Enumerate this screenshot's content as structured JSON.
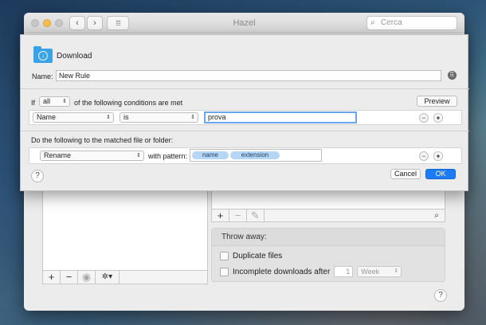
{
  "window": {
    "title": "Hazel",
    "search_placeholder": "Cerca",
    "back_glyph": "‹",
    "forward_glyph": "›"
  },
  "sheet": {
    "folder_name": "Download",
    "name_label": "Name:",
    "name_value": "New Rule",
    "if_label": "If",
    "match_mode": "all",
    "conditions_suffix": "of the following conditions are met",
    "preview_label": "Preview",
    "condition": {
      "attribute": "Name",
      "operator": "is",
      "value": "prova"
    },
    "actions_label": "Do the following to the matched file or folder:",
    "action": {
      "type": "Rename",
      "pattern_label": "with pattern:",
      "tokens": [
        "name",
        "extension"
      ]
    },
    "help_label": "?",
    "cancel_label": "Cancel",
    "ok_label": "OK",
    "minus_label": "−",
    "plus_label": "+"
  },
  "background": {
    "left_toolbar": {
      "add": "+",
      "remove": "−",
      "eye": "◉",
      "gear": "✲▾"
    },
    "right_toolbar": {
      "add": "+",
      "remove": "−",
      "edit": "✎",
      "search": "⌕"
    },
    "throw_away": {
      "title": "Throw away:",
      "duplicate_files": "Duplicate files",
      "incomplete_downloads": "Incomplete downloads after",
      "incomplete_value": "1",
      "unit": "Week"
    },
    "help_label": "?"
  },
  "icons": {
    "search": "search-icon",
    "folder": "download-folder-icon",
    "share": "share-icon"
  },
  "colors": {
    "accent": "#1b7cf5",
    "token": "#b6d6f6",
    "folder": "#3aa3e8",
    "minimize_light": "#f5bf4f"
  }
}
